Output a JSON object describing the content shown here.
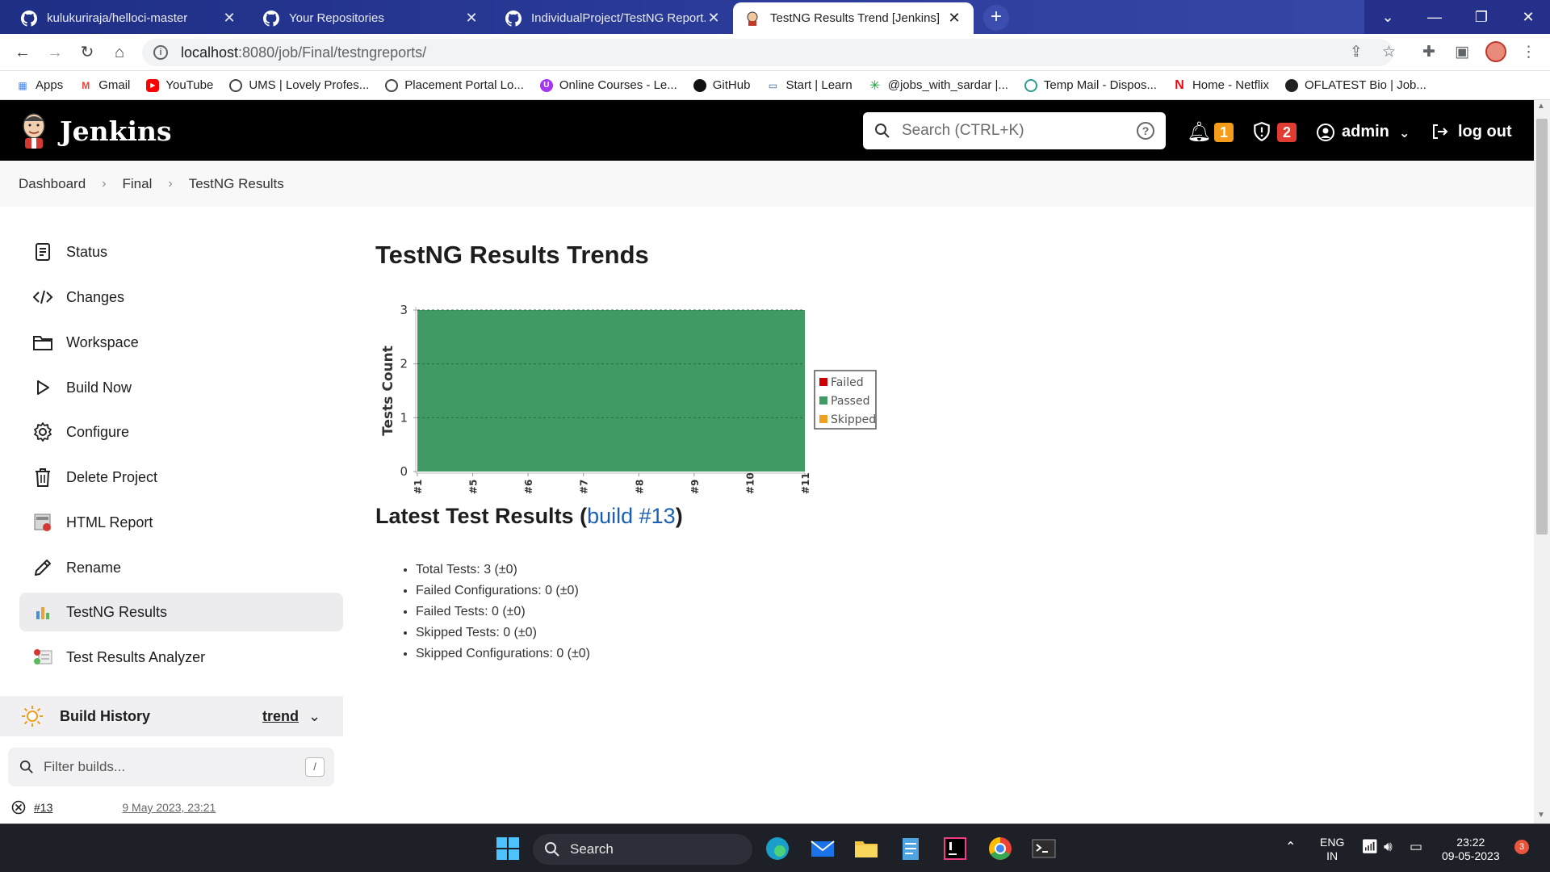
{
  "browser": {
    "tabs": [
      {
        "title": "kulukuriraja/helloci-master",
        "icon": "github-icon",
        "active": false
      },
      {
        "title": "Your Repositories",
        "icon": "github-icon",
        "active": false
      },
      {
        "title": "IndividualProject/TestNG Report...",
        "icon": "github-icon",
        "active": false
      },
      {
        "title": "TestNG Results Trend [Jenkins]",
        "icon": "jenkins-icon",
        "active": true
      }
    ],
    "url_host": "localhost",
    "url_rest": ":8080/job/Final/testngreports/",
    "bookmarks": [
      {
        "label": "Apps",
        "icon": "apps-grid-icon"
      },
      {
        "label": "Gmail",
        "icon": "gmail-icon"
      },
      {
        "label": "YouTube",
        "icon": "youtube-icon"
      },
      {
        "label": "UMS | Lovely Profes...",
        "icon": "globe-icon"
      },
      {
        "label": "Placement Portal Lo...",
        "icon": "globe-icon"
      },
      {
        "label": "Online Courses - Le...",
        "icon": "udemy-icon"
      },
      {
        "label": "GitHub",
        "icon": "github-icon"
      },
      {
        "label": "Start | Learn",
        "icon": "learn-icon"
      },
      {
        "label": "@jobs_with_sardar |...",
        "icon": "star-burst-icon"
      },
      {
        "label": "Temp Mail - Dispos...",
        "icon": "tempmail-icon"
      },
      {
        "label": "Home - Netflix",
        "icon": "netflix-icon"
      },
      {
        "label": "OFLATEST Bio | Job...",
        "icon": "oflatest-icon"
      }
    ]
  },
  "header": {
    "title": "Jenkins",
    "search_placeholder": "Search (CTRL+K)",
    "help": "?",
    "notifications_count": "1",
    "security_count": "2",
    "user": "admin",
    "logout": "log out"
  },
  "breadcrumb": [
    "Dashboard",
    "Final",
    "TestNG Results"
  ],
  "sidebar": {
    "tasks": [
      {
        "label": "Status",
        "icon": "status-icon"
      },
      {
        "label": "Changes",
        "icon": "code-icon"
      },
      {
        "label": "Workspace",
        "icon": "folder-icon"
      },
      {
        "label": "Build Now",
        "icon": "play-icon"
      },
      {
        "label": "Configure",
        "icon": "gear-icon"
      },
      {
        "label": "Delete Project",
        "icon": "trash-icon"
      },
      {
        "label": "HTML Report",
        "icon": "html-report-icon"
      },
      {
        "label": "Rename",
        "icon": "pencil-icon"
      },
      {
        "label": "TestNG Results",
        "icon": "testng-chart-icon"
      },
      {
        "label": "Test Results Analyzer",
        "icon": "analyzer-icon"
      }
    ],
    "build_history": {
      "title": "Build History",
      "trend": "trend",
      "filter_placeholder": "Filter builds...",
      "filter_shortcut": "/",
      "builds": [
        {
          "number": "#13",
          "date": "9 May 2023, 23:21"
        }
      ]
    }
  },
  "main": {
    "title": "TestNG Results Trends",
    "latest_prefix": "Latest Test Results (",
    "latest_link": "build #13",
    "latest_suffix": ")",
    "results": [
      "Total Tests: 3 (±0)",
      "Failed Configurations: 0 (±0)",
      "Failed Tests: 0 (±0)",
      "Skipped Tests: 0 (±0)",
      "Skipped Configurations: 0 (±0)"
    ]
  },
  "chart_data": {
    "type": "area",
    "ylabel": "Tests Count",
    "xlabel": "",
    "x": [
      "#1",
      "#5",
      "#6",
      "#7",
      "#8",
      "#9",
      "#10",
      "#11"
    ],
    "ylim": [
      0,
      3
    ],
    "yticks": [
      0,
      1,
      2,
      3
    ],
    "grid": true,
    "legend": "right",
    "series": [
      {
        "name": "Failed",
        "color": "#cc0000",
        "values": [
          0,
          0,
          0,
          0,
          0,
          0,
          0,
          0
        ]
      },
      {
        "name": "Passed",
        "color": "#3f9a63",
        "values": [
          3,
          3,
          3,
          3,
          3,
          3,
          3,
          3
        ]
      },
      {
        "name": "Skipped",
        "color": "#f0a020",
        "values": [
          0,
          0,
          0,
          0,
          0,
          0,
          0,
          0
        ]
      }
    ]
  },
  "taskbar": {
    "search": "Search",
    "lang1": "ENG",
    "lang2": "IN",
    "time": "23:22",
    "date": "09-05-2023",
    "notif_count": "3"
  }
}
